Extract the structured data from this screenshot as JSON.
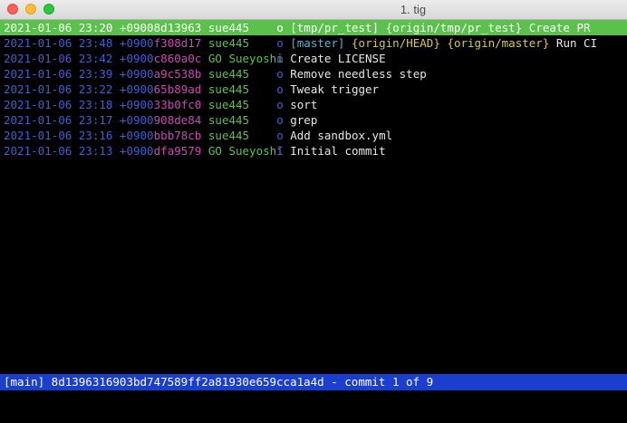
{
  "window": {
    "title": "1. tig"
  },
  "commits": [
    {
      "date": "2021-01-06 23:20 +0900",
      "hash": "8d13963",
      "author": "sue445",
      "graph": "o",
      "refs": [
        {
          "text": "[tmp/pr_test]",
          "kind": "local"
        },
        {
          "text": "{origin/tmp/pr_test}",
          "kind": "remote"
        }
      ],
      "message": "Create PR"
    },
    {
      "date": "2021-01-06 23:48 +0900",
      "hash": "f308d17",
      "author": "sue445",
      "graph": "o",
      "refs": [
        {
          "text": "[master]",
          "kind": "local"
        },
        {
          "text": "{origin/HEAD}",
          "kind": "remote"
        },
        {
          "text": "{origin/master}",
          "kind": "remote"
        }
      ],
      "message": "Run CI"
    },
    {
      "date": "2021-01-06 23:42 +0900",
      "hash": "c860a0c",
      "author": "GO Sueyoshi",
      "graph": "o",
      "refs": [],
      "message": "Create LICENSE"
    },
    {
      "date": "2021-01-06 23:39 +0900",
      "hash": "a9c538b",
      "author": "sue445",
      "graph": "o",
      "refs": [],
      "message": "Remove needless step"
    },
    {
      "date": "2021-01-06 23:22 +0900",
      "hash": "65b89ad",
      "author": "sue445",
      "graph": "o",
      "refs": [],
      "message": "Tweak trigger"
    },
    {
      "date": "2021-01-06 23:18 +0900",
      "hash": "33b0fc0",
      "author": "sue445",
      "graph": "o",
      "refs": [],
      "message": "sort"
    },
    {
      "date": "2021-01-06 23:17 +0900",
      "hash": "908de84",
      "author": "sue445",
      "graph": "o",
      "refs": [],
      "message": "grep"
    },
    {
      "date": "2021-01-06 23:16 +0900",
      "hash": "bbb78cb",
      "author": "sue445",
      "graph": "o",
      "refs": [],
      "message": "Add sandbox.yml"
    },
    {
      "date": "2021-01-06 23:13 +0900",
      "hash": "dfa9579",
      "author": "GO Sueyoshi",
      "graph": "I",
      "refs": [],
      "message": "Initial commit"
    }
  ],
  "selected_index": 0,
  "status_bar": {
    "text": "[main] 8d1396316903bd747589ff2a81930e659cca1a4d - commit 1 of 9"
  },
  "colors": {
    "date": "#3d5fd8",
    "hash": "#c64ab4",
    "author": "#5ac24a",
    "selected_bg": "#5ac24a",
    "status_bg": "#1a3fd0",
    "local_ref": "#4fb5d6",
    "remote_ref": "#d9c64a"
  }
}
